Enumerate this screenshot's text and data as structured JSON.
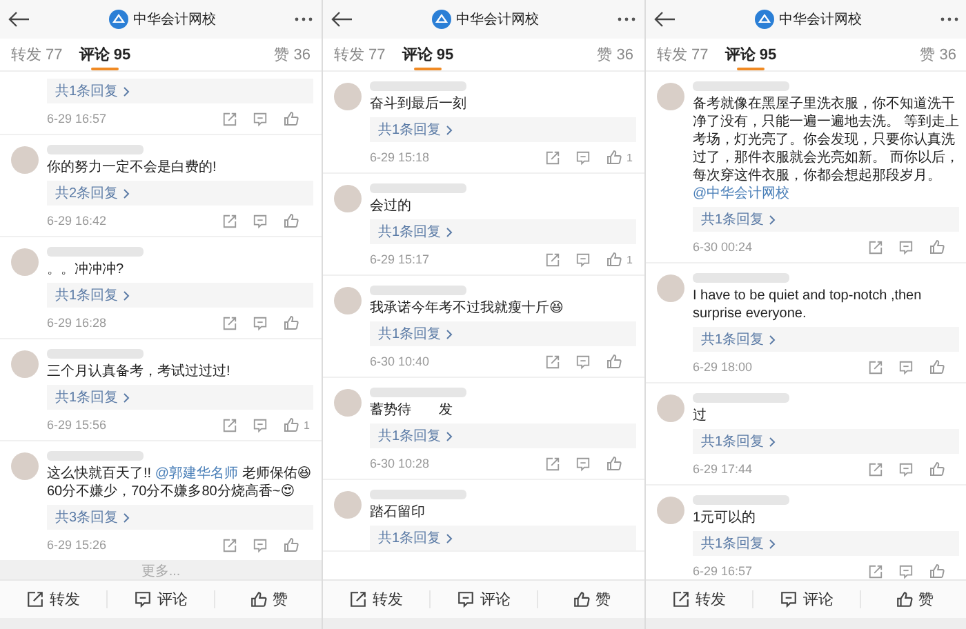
{
  "panels": [
    {
      "header": {
        "title": "中华会计网校"
      },
      "tabs": [
        {
          "label": "转发 77",
          "selected": false
        },
        {
          "label": "评论 95",
          "selected": true
        },
        {
          "label": "赞 36",
          "selected": false
        }
      ],
      "comments": [
        {
          "reply": "共1条回复",
          "time": "6-29 16:57"
        },
        {
          "parts": [
            {
              "kind": "text",
              "text": "你的努力一定不会是白费的!"
            }
          ],
          "reply": "共2条回复",
          "time": "6-29 16:42"
        },
        {
          "parts": [
            {
              "kind": "text",
              "text": "。。冲冲冲?"
            }
          ],
          "reply": "共1条回复",
          "time": "6-29 16:28"
        },
        {
          "parts": [
            {
              "kind": "text",
              "text": "三个月认真备考，考试过过过!"
            }
          ],
          "reply": "共1条回复",
          "time": "6-29 15:56",
          "likes": "1"
        },
        {
          "parts": [
            {
              "kind": "text",
              "text": "这么快就百天了!! "
            },
            {
              "kind": "mention",
              "text": "@郭建华名师"
            },
            {
              "kind": "text",
              "text": " 老师保佑😆60分不嫌少，70分不嫌多80分烧高香~😍"
            }
          ],
          "reply": "共3条回复",
          "time": "6-29 15:26"
        }
      ],
      "more": "更多...",
      "bottom_bar": [
        {
          "kind": "repost",
          "label": "转发"
        },
        {
          "kind": "comment",
          "label": "评论"
        },
        {
          "kind": "like",
          "label": "赞"
        }
      ]
    },
    {
      "header": {
        "title": "中华会计网校"
      },
      "tabs": [
        {
          "label": "转发 77",
          "selected": false
        },
        {
          "label": "评论 95",
          "selected": true
        },
        {
          "label": "赞 36",
          "selected": false
        }
      ],
      "comments": [
        {
          "parts": [
            {
              "kind": "text",
              "text": "奋斗到最后一刻"
            }
          ],
          "reply": "共1条回复",
          "time": "6-29 15:18",
          "likes": "1"
        },
        {
          "parts": [
            {
              "kind": "text",
              "text": "会过的"
            }
          ],
          "reply": "共1条回复",
          "time": "6-29 15:17",
          "likes": "1"
        },
        {
          "parts": [
            {
              "kind": "text",
              "text": "我承诺今年考不过我就瘦十斤😆"
            }
          ],
          "reply": "共1条回复",
          "time": "6-30 10:40"
        },
        {
          "parts": [
            {
              "kind": "text",
              "text": "蓄势待　　发"
            }
          ],
          "reply": "共1条回复",
          "time": "6-30 10:28"
        },
        {
          "parts": [
            {
              "kind": "text",
              "text": "踏石留印"
            }
          ],
          "reply": "共1条回复"
        }
      ],
      "bottom_bar": [
        {
          "kind": "repost",
          "label": "转发"
        },
        {
          "kind": "comment",
          "label": "评论"
        },
        {
          "kind": "like",
          "label": "赞"
        }
      ]
    },
    {
      "header": {
        "title": "中华会计网校"
      },
      "tabs": [
        {
          "label": "转发 77",
          "selected": false
        },
        {
          "label": "评论 95",
          "selected": true
        },
        {
          "label": "赞 36",
          "selected": false
        }
      ],
      "comments": [
        {
          "parts": [
            {
              "kind": "text",
              "text": "备考就像在黑屋子里洗衣服，你不知道洗干净了没有，只能一遍一遍地去洗。 等到走上考场，灯光亮了。你会发现，只要你认真洗过了，那件衣服就会光亮如新。 而你以后，每次穿这件衣服，你都会想起那段岁月。"
            },
            {
              "kind": "mention",
              "text": "@中华会计网校"
            }
          ],
          "reply": "共1条回复",
          "time": "6-30 00:24"
        },
        {
          "parts": [
            {
              "kind": "text",
              "text": "I have to be quiet and top-notch ,then surprise everyone."
            }
          ],
          "reply": "共1条回复",
          "time": "6-29 18:00"
        },
        {
          "parts": [
            {
              "kind": "text",
              "text": "过"
            }
          ],
          "reply": "共1条回复",
          "time": "6-29 17:44"
        },
        {
          "parts": [
            {
              "kind": "text",
              "text": "1元可以的"
            }
          ],
          "reply": "共1条回复",
          "time": "6-29 16:57"
        }
      ],
      "bottom_bar": [
        {
          "kind": "repost",
          "label": "转发"
        },
        {
          "kind": "comment",
          "label": "评论"
        },
        {
          "kind": "like",
          "label": "赞"
        }
      ]
    }
  ]
}
